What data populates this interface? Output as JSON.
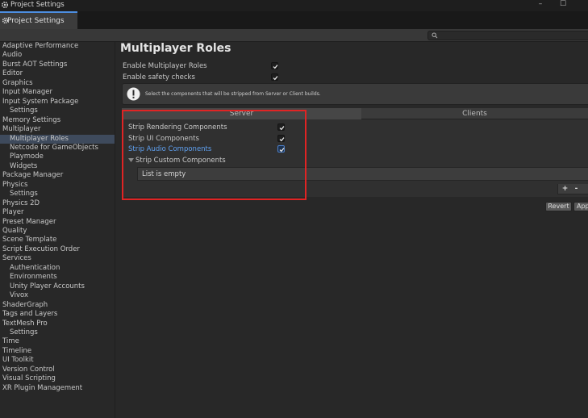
{
  "window": {
    "title": "Project Settings"
  },
  "tab": {
    "label": "Project Settings"
  },
  "sidebar": {
    "items": [
      {
        "label": "Adaptive Performance",
        "indent": 0
      },
      {
        "label": "Audio",
        "indent": 0
      },
      {
        "label": "Burst AOT Settings",
        "indent": 0
      },
      {
        "label": "Editor",
        "indent": 0
      },
      {
        "label": "Graphics",
        "indent": 0
      },
      {
        "label": "Input Manager",
        "indent": 0
      },
      {
        "label": "Input System Package",
        "indent": 0
      },
      {
        "label": "Settings",
        "indent": 1
      },
      {
        "label": "Memory Settings",
        "indent": 0
      },
      {
        "label": "Multiplayer",
        "indent": 0
      },
      {
        "label": "Multiplayer Roles",
        "indent": 1,
        "selected": true
      },
      {
        "label": "Netcode for GameObjects",
        "indent": 1
      },
      {
        "label": "Playmode",
        "indent": 1
      },
      {
        "label": "Widgets",
        "indent": 1
      },
      {
        "label": "Package Manager",
        "indent": 0
      },
      {
        "label": "Physics",
        "indent": 0
      },
      {
        "label": "Settings",
        "indent": 1
      },
      {
        "label": "Physics 2D",
        "indent": 0
      },
      {
        "label": "Player",
        "indent": 0
      },
      {
        "label": "Preset Manager",
        "indent": 0
      },
      {
        "label": "Quality",
        "indent": 0
      },
      {
        "label": "Scene Template",
        "indent": 0
      },
      {
        "label": "Script Execution Order",
        "indent": 0
      },
      {
        "label": "Services",
        "indent": 0
      },
      {
        "label": "Authentication",
        "indent": 1
      },
      {
        "label": "Environments",
        "indent": 1
      },
      {
        "label": "Unity Player Accounts",
        "indent": 1
      },
      {
        "label": "Vivox",
        "indent": 1
      },
      {
        "label": "ShaderGraph",
        "indent": 0
      },
      {
        "label": "Tags and Layers",
        "indent": 0
      },
      {
        "label": "TextMesh Pro",
        "indent": 0
      },
      {
        "label": "Settings",
        "indent": 1
      },
      {
        "label": "Time",
        "indent": 0
      },
      {
        "label": "Timeline",
        "indent": 0
      },
      {
        "label": "UI Toolkit",
        "indent": 0
      },
      {
        "label": "Version Control",
        "indent": 0
      },
      {
        "label": "Visual Scripting",
        "indent": 0
      },
      {
        "label": "XR Plugin Management",
        "indent": 0
      }
    ]
  },
  "main": {
    "title": "Multiplayer Roles",
    "enable_roles": {
      "label": "Enable Multiplayer Roles",
      "checked": true
    },
    "enable_safety": {
      "label": "Enable safety checks",
      "checked": true
    },
    "help_text": "Select the components that will be stripped from Server or Client builds.",
    "tabs": {
      "server": "Server",
      "clients": "Clients"
    },
    "strip_rendering": {
      "label": "Strip Rendering Components",
      "checked": true
    },
    "strip_ui": {
      "label": "Strip UI Components",
      "checked": true
    },
    "strip_audio": {
      "label": "Strip Audio Components",
      "checked": true
    },
    "strip_custom": {
      "label": "Strip Custom Components"
    },
    "list_empty": "List is empty",
    "add_label": "+",
    "remove_label": "-",
    "revert_label": "Revert",
    "apply_label": "Apply"
  },
  "colors": {
    "accent_blue": "#4d8ee0",
    "highlight_label": "#5fa0f0",
    "annotation_red": "#e02424",
    "selected_bg": "#3e4a5c"
  }
}
